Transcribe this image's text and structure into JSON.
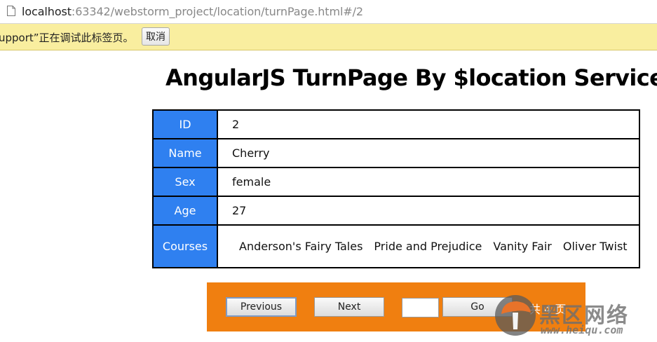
{
  "browser": {
    "url_host": "localhost",
    "url_rest": ":63342/webstorm_project/location/turnPage.html#/2"
  },
  "infobar": {
    "message": "upport”正在调试此标签页。",
    "cancel_label": "取消"
  },
  "page": {
    "title": "AngularJS TurnPage By $location Service"
  },
  "record": {
    "rows": [
      {
        "label": "ID",
        "value": "2"
      },
      {
        "label": "Name",
        "value": "Cherry"
      },
      {
        "label": "Sex",
        "value": "female"
      },
      {
        "label": "Age",
        "value": "27"
      }
    ],
    "courses_label": "Courses",
    "courses": [
      "Anderson's Fairy Tales",
      "Pride and Prejudice",
      "Vanity Fair",
      "Oliver Twist"
    ]
  },
  "pager": {
    "previous_label": "Previous",
    "next_label": "Next",
    "page_input_value": "",
    "go_label": "Go",
    "total_text": "共 4 页"
  },
  "watermark": {
    "title": "黑区网络",
    "url": "www.heiqu.com"
  },
  "colors": {
    "label_bg": "#2f80f0",
    "pager_bg": "#f07f10",
    "infobar_bg": "#f9ee9f"
  }
}
